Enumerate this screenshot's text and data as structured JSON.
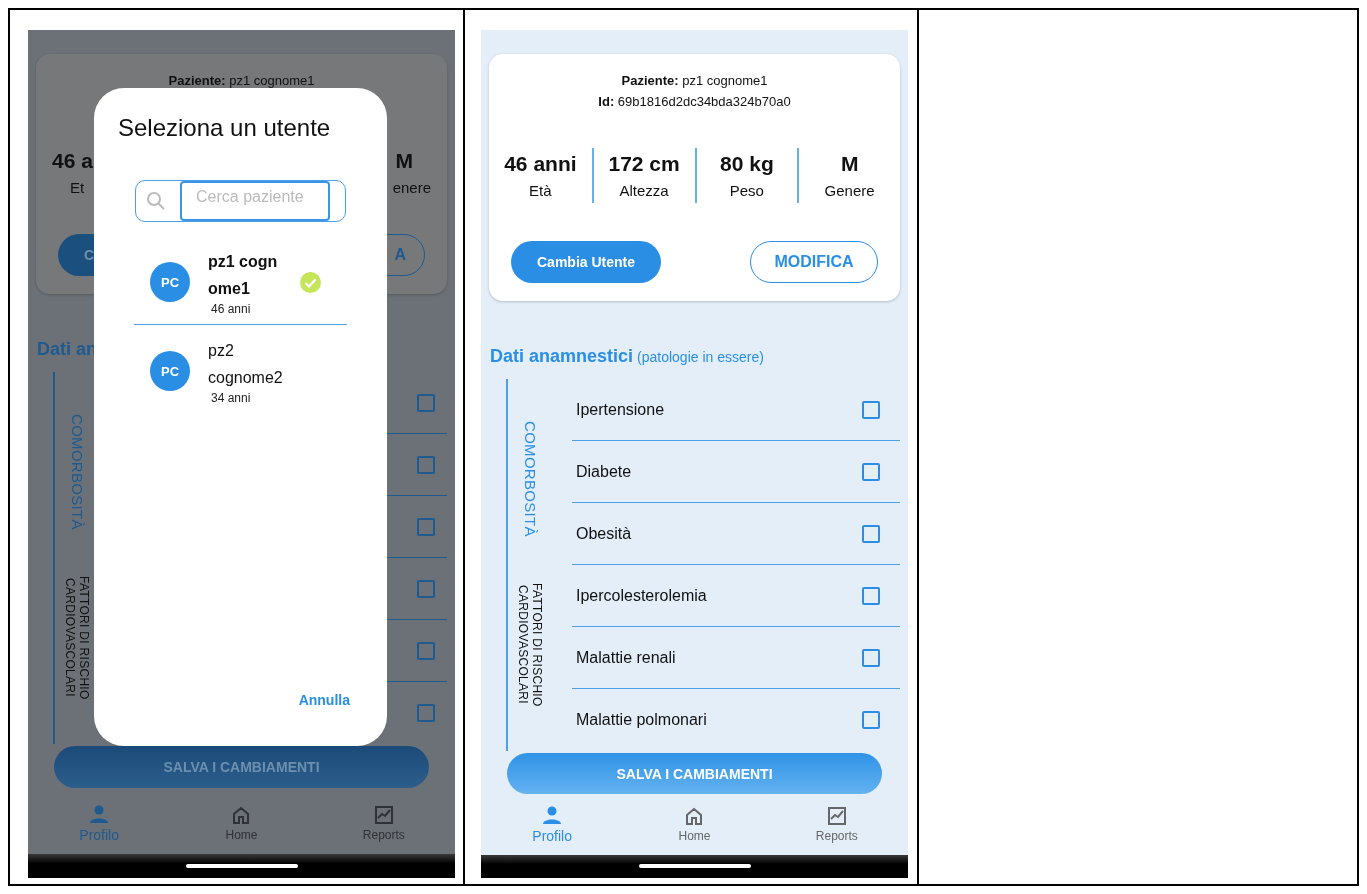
{
  "dialog_screen": {
    "background": {
      "patient": "**Paziente:** pz1 cognome1",
      "stat_value_left": "46 a",
      "stat_value_right": "M",
      "stat_label_left": "Et",
      "stat_label_right": "enere",
      "button_left": "C",
      "button_right": "A",
      "section_title": "Dati an",
      "groups": [
        {
          "label": "COMORBOSITÀ",
          "selected": true
        },
        {
          "label": "FATTORI DI RISCHIO CARDIOVASCOLARI",
          "selected": false
        }
      ],
      "checkboxes": [
        {
          "checked": false
        },
        {
          "checked": false
        },
        {
          "checked": false
        },
        {
          "checked": false
        },
        {
          "checked": false
        },
        {
          "checked": false
        }
      ],
      "save_button": "SALVA I CAMBIAMENTI",
      "nav": [
        {
          "label": "Profilo",
          "selected": true
        },
        {
          "label": "Home",
          "selected": false
        },
        {
          "label": "Reports",
          "selected": false
        }
      ]
    },
    "dialog": {
      "title": "Seleziona un utente",
      "search": {
        "placeholder": "Cerca paziente"
      },
      "users": [
        {
          "avatar": "PC",
          "name": "pz1 cognome1",
          "age": "46 anni",
          "selected": true
        },
        {
          "avatar": "PC",
          "name": "pz2 cognome2",
          "age": "34 anni",
          "selected": false
        }
      ],
      "cancel": "Annulla"
    }
  },
  "profile_screen": {
    "patient": "**Paziente:** pz1 cognome1",
    "id": "**Id:** 69b1816d2dc34bda324b70a0",
    "stats": [
      {
        "value": "46 anni",
        "label": "Età"
      },
      {
        "value": "172 cm",
        "label": "Altezza"
      },
      {
        "value": "80 kg",
        "label": "Peso"
      },
      {
        "value": "M",
        "label": "Genere"
      }
    ],
    "change_user": "Cambia Utente",
    "edit": "MODIFICA",
    "section": {
      "title": "Dati anamnestici",
      "subtitle": "(patologie in essere)"
    },
    "groups": [
      {
        "label": "COMORBOSITÀ",
        "selected": true
      },
      {
        "label": "FATTORI DI RISCHIO CARDIOVASCOLARI",
        "selected": false
      }
    ],
    "conditions": [
      {
        "label": "Ipertensione",
        "checked": false
      },
      {
        "label": "Diabete",
        "checked": false
      },
      {
        "label": "Obesità",
        "checked": false
      },
      {
        "label": "Ipercolesterolemia",
        "checked": false
      },
      {
        "label": "Malattie renali",
        "checked": false
      },
      {
        "label": "Malattie polmonari",
        "checked": false
      }
    ],
    "save_button": "SALVA I CAMBIAMENTI",
    "nav": [
      {
        "label": "Profilo",
        "selected": true
      },
      {
        "label": "Home",
        "selected": false
      },
      {
        "label": "Reports",
        "selected": false
      }
    ]
  }
}
